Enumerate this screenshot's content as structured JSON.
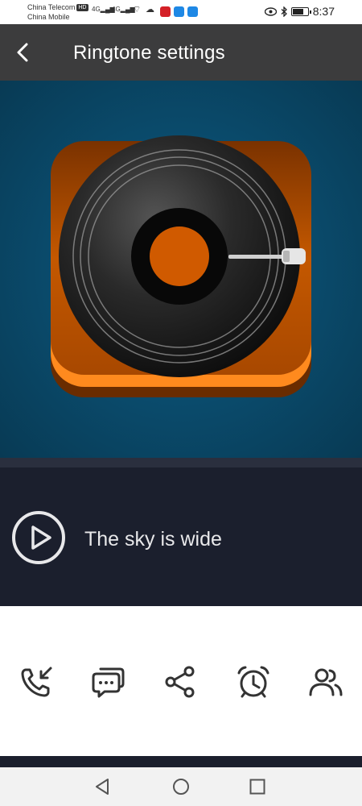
{
  "status_bar": {
    "carrier_1": "China Telecom",
    "carrier_1_badge": "HD",
    "carrier_2": "China Mobile",
    "signal_1": "4G",
    "signal_2": "4G",
    "time": "8:37",
    "battery_level": 0.75
  },
  "header": {
    "title": "Ringtone settings",
    "back_icon": "chevron-left-icon"
  },
  "cover": {
    "image": "vinyl-record-app-icon",
    "colors": {
      "background": "#0a4b6c",
      "tile": "#c85a00",
      "record": "#1a1a1a",
      "label": "#c85a00"
    }
  },
  "player": {
    "play_icon": "play-circle-icon",
    "song_title": "The sky is wide"
  },
  "actions": [
    {
      "id": "call-ringtone",
      "icon": "phone-incoming-icon"
    },
    {
      "id": "message-ringtone",
      "icon": "chat-bubble-icon"
    },
    {
      "id": "share",
      "icon": "share-icon"
    },
    {
      "id": "alarm",
      "icon": "alarm-clock-icon"
    },
    {
      "id": "contacts",
      "icon": "contacts-icon"
    }
  ],
  "nav": {
    "back_icon": "nav-back-triangle-icon",
    "home_icon": "nav-home-circle-icon",
    "recents_icon": "nav-recents-square-icon"
  }
}
